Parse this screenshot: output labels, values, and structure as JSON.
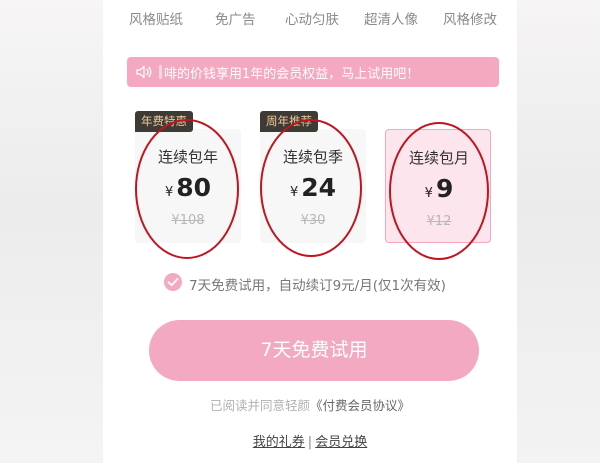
{
  "features": [
    "风格贴纸",
    "免广告",
    "心动匀肤",
    "超清人像",
    "风格修改"
  ],
  "notice": {
    "text": "啡的价钱享用1年的会员权益，马上试用吧！",
    "icon": "speaker-icon"
  },
  "plans": [
    {
      "badge": "年费特惠",
      "name": "连续包年",
      "currency": "¥",
      "price": "80",
      "original": "¥108",
      "selected": false
    },
    {
      "badge": "周年推荐",
      "name": "连续包季",
      "currency": "¥",
      "price": "24",
      "original": "¥30",
      "selected": false
    },
    {
      "badge": "",
      "name": "连续包月",
      "currency": "¥",
      "price": "9",
      "original": "¥12",
      "selected": true
    }
  ],
  "trial_note": "7天免费试用，自动续订9元/月(仅1次有效)",
  "cta_label": "7天免费试用",
  "agreement": {
    "text": "已阅读并同意轻颜",
    "link": "《付费会员协议》"
  },
  "links": {
    "coupons": "我的礼券",
    "separator": "|",
    "redeem": "会员兑换"
  },
  "colors": {
    "accent_pink": "#f4a9c3",
    "badge_dark": "#3e3a36",
    "badge_gold": "#ecc996",
    "annotation_red": "#c0141e"
  }
}
